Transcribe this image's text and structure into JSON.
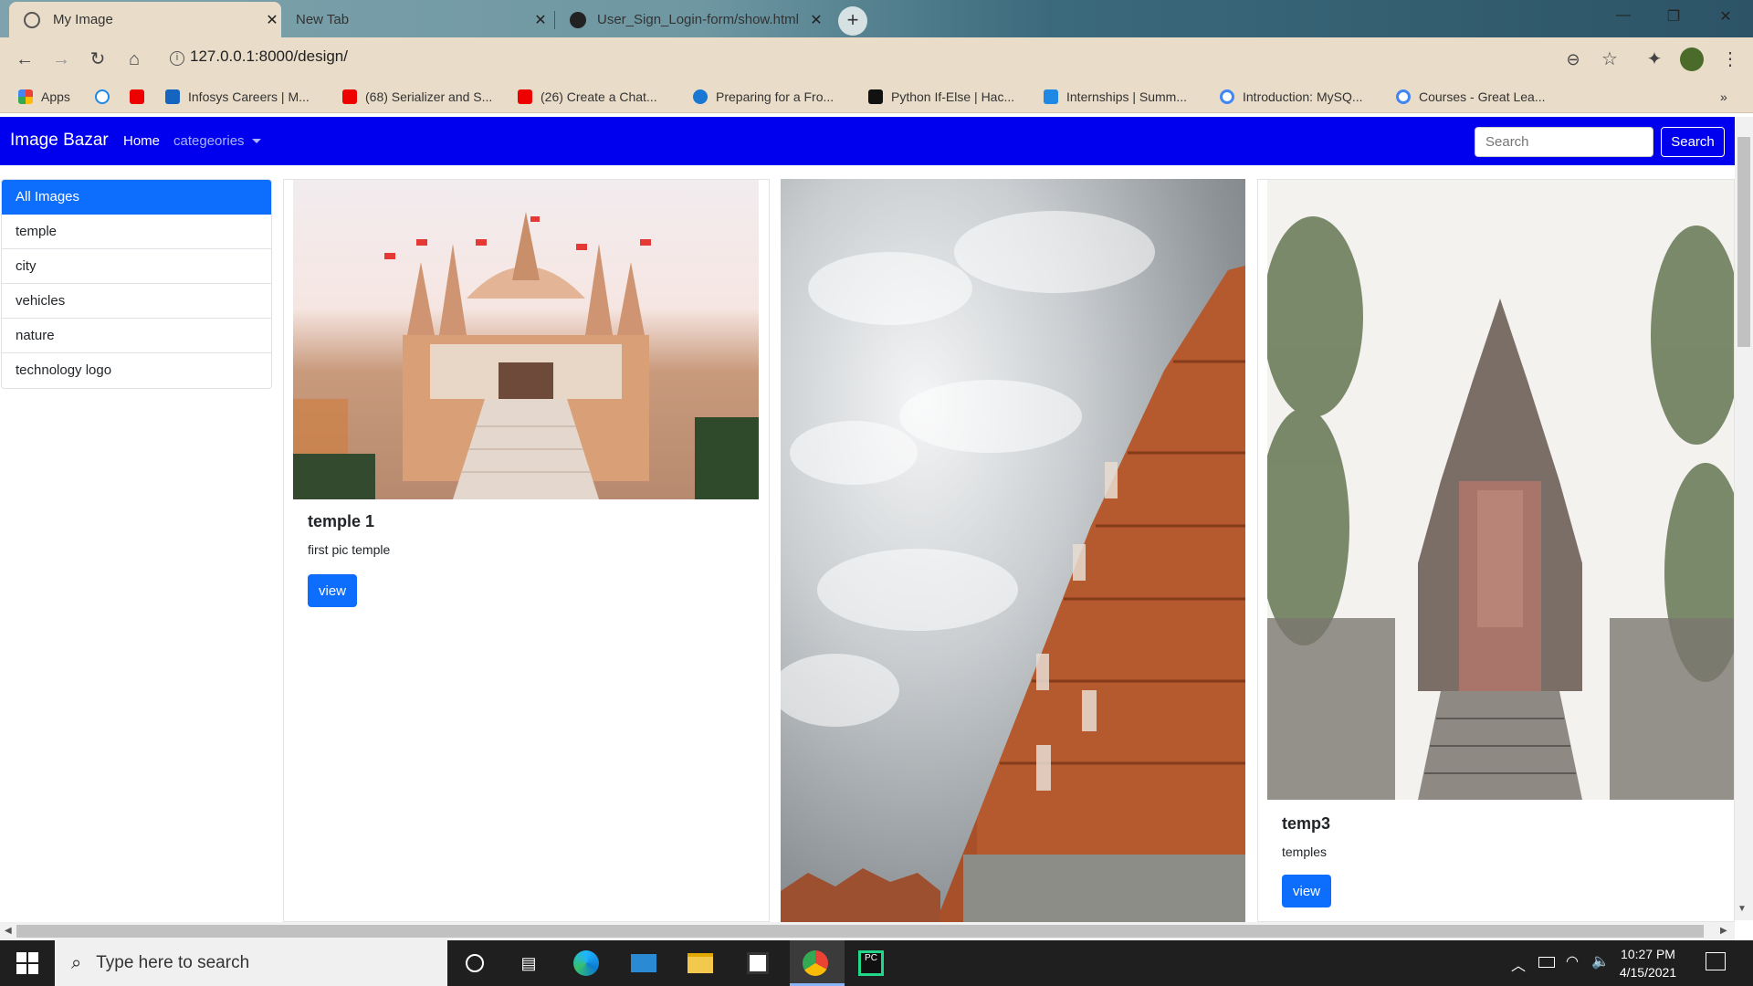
{
  "browser": {
    "tabs": [
      {
        "title": "My Image",
        "active": true
      },
      {
        "title": "New Tab",
        "active": false
      },
      {
        "title": "User_Sign_Login-form/show.html",
        "active": false
      }
    ],
    "url": "127.0.0.1:8000/design/",
    "bookmarks": [
      {
        "label": "Apps",
        "icon": "apps-grid-icon"
      },
      {
        "label": "",
        "icon": "k-logo-icon"
      },
      {
        "label": "",
        "icon": "youtube-icon"
      },
      {
        "label": "Infosys Careers | M...",
        "icon": "infosys-icon"
      },
      {
        "label": "(68) Serializer and S...",
        "icon": "youtube-icon"
      },
      {
        "label": "(26) Create a Chat...",
        "icon": "youtube-icon"
      },
      {
        "label": "Preparing for a Fro...",
        "icon": "globe-icon"
      },
      {
        "label": "Python If-Else | Hac...",
        "icon": "hackerrank-icon"
      },
      {
        "label": "Internships | Summ...",
        "icon": "internshala-icon"
      },
      {
        "label": "Introduction: MySQ...",
        "icon": "google-icon"
      },
      {
        "label": "Courses - Great Lea...",
        "icon": "google-icon"
      }
    ]
  },
  "navbar": {
    "brand": "Image Bazar",
    "home": "Home",
    "categories": "categeories",
    "search_placeholder": "Search",
    "search_button": "Search",
    "bg_color": "#0000ee"
  },
  "sidebar": {
    "items": [
      {
        "label": "All Images",
        "active": true
      },
      {
        "label": "temple",
        "active": false
      },
      {
        "label": "city",
        "active": false
      },
      {
        "label": "vehicles",
        "active": false
      },
      {
        "label": "nature",
        "active": false
      },
      {
        "label": "technology logo",
        "active": false
      }
    ]
  },
  "cards": [
    {
      "title": "temple 1",
      "text": "first pic temple",
      "button": "view"
    },
    {
      "title": "",
      "text": "",
      "button": ""
    },
    {
      "title": "temp3",
      "text": "temples",
      "button": "view"
    }
  ],
  "taskbar": {
    "search_placeholder": "Type here to search",
    "time": "10:27 PM",
    "date": "4/15/2021"
  }
}
